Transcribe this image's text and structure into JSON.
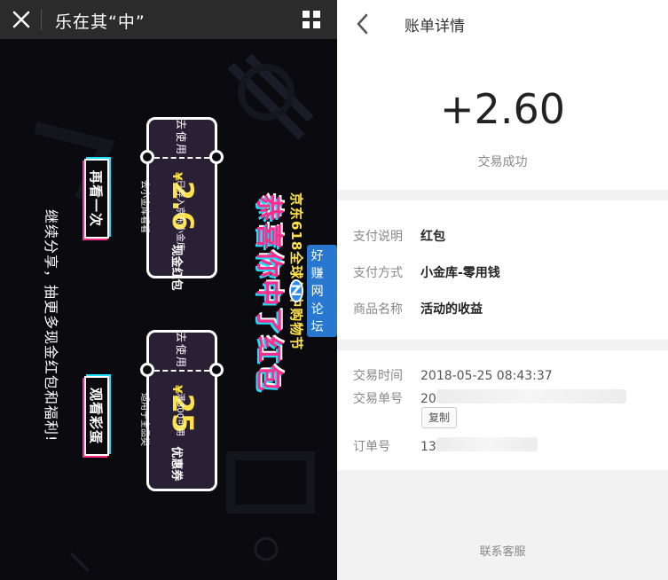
{
  "left": {
    "header": {
      "title": "乐在其“中”",
      "close_icon": "close-icon",
      "menu_icon": "grid-menu-icon"
    },
    "continue_text": "继续分享，抽更多现金红包和福利!",
    "watch_again_button": "再看一次",
    "watch_egg_button": "观看彩蛋",
    "headline": "恭喜你中了红包",
    "subheadline": "京东618全球年中购物节",
    "ticket1": {
      "use_label": "去使用",
      "currency": "¥",
      "amount": "2.6",
      "type": "现金红包",
      "desc1": "已存入京东小金库",
      "desc2": "去小金库看看"
    },
    "ticket2": {
      "use_label": "去使用",
      "currency": "¥",
      "amount": "25",
      "type": "优惠券",
      "desc1": "满300可用",
      "desc2": "适用于全品类"
    },
    "watermark": "好赚网论坛",
    "watermark_letter": "Z"
  },
  "right": {
    "header": {
      "title": "账单详情",
      "back_icon": "chevron-left-icon"
    },
    "amount": "+2.60",
    "status": "交易成功",
    "details": [
      {
        "label": "支付说明",
        "value": "红包"
      },
      {
        "label": "支付方式",
        "value": "小金库-零用钱"
      },
      {
        "label": "商品名称",
        "value": "活动的收益"
      }
    ],
    "meta": {
      "time_label": "交易时间",
      "time_value": "2018-05-25 08:43:37",
      "txn_label": "交易单号",
      "txn_value": "20",
      "copy_button": "复制",
      "order_label": "订单号",
      "order_value": "13"
    },
    "service": "联系客服"
  }
}
